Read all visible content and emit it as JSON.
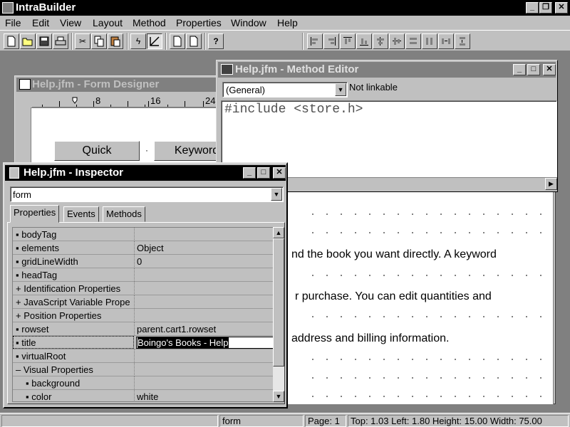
{
  "app": {
    "title": "IntraBuilder",
    "controls": {
      "minimize": "_",
      "restore": "❐",
      "close": "✕"
    }
  },
  "menu": [
    "File",
    "Edit",
    "View",
    "Layout",
    "Method",
    "Properties",
    "Window",
    "Help"
  ],
  "toolbar": {
    "help_label": "?"
  },
  "form_designer": {
    "title": "Help.jfm - Form Designer",
    "ruler": [
      "8",
      "16",
      "24"
    ],
    "buttons": {
      "quick": "Quick",
      "keyword": "Keyword"
    },
    "text_lines": [
      "nd the book you want directly. A keyword",
      "r purchase. You can edit quantities and",
      "address and billing information."
    ]
  },
  "method_editor": {
    "title": "Help.jfm - Method Editor",
    "combo_value": "(General)",
    "link_status": "Not linkable",
    "code": "#include <store.h>"
  },
  "inspector": {
    "title": "Help.jfm - Inspector",
    "object_combo": "form",
    "tabs": [
      "Properties",
      "Events",
      "Methods"
    ],
    "active_tab": "Properties",
    "rows": [
      {
        "marker": "▪",
        "name": "bodyTag",
        "value": ""
      },
      {
        "marker": "▪",
        "name": "elements",
        "value": "Object"
      },
      {
        "marker": "▪",
        "name": "gridLineWidth",
        "value": "0"
      },
      {
        "marker": "▪",
        "name": "headTag",
        "value": ""
      },
      {
        "marker": "+",
        "name": "Identification Properties",
        "value": ""
      },
      {
        "marker": "+",
        "name": "JavaScript Variable Prope",
        "value": ""
      },
      {
        "marker": "+",
        "name": "Position Properties",
        "value": ""
      },
      {
        "marker": "▪",
        "name": "rowset",
        "value": "parent.cart1.rowset"
      },
      {
        "marker": "▪",
        "name": "title",
        "value": "Boingo's Books - Help"
      },
      {
        "marker": "▪",
        "name": "virtualRoot",
        "value": ""
      },
      {
        "marker": "–",
        "name": "Visual Properties",
        "value": ""
      },
      {
        "marker": "▪",
        "name": "background",
        "value": ""
      },
      {
        "marker": "▪",
        "name": "color",
        "value": "white"
      }
    ]
  },
  "statusbar": {
    "object": "form",
    "page": "Page: 1",
    "metrics": "Top: 1.03 Left: 1.80 Height: 15.00 Width: 75.00"
  }
}
